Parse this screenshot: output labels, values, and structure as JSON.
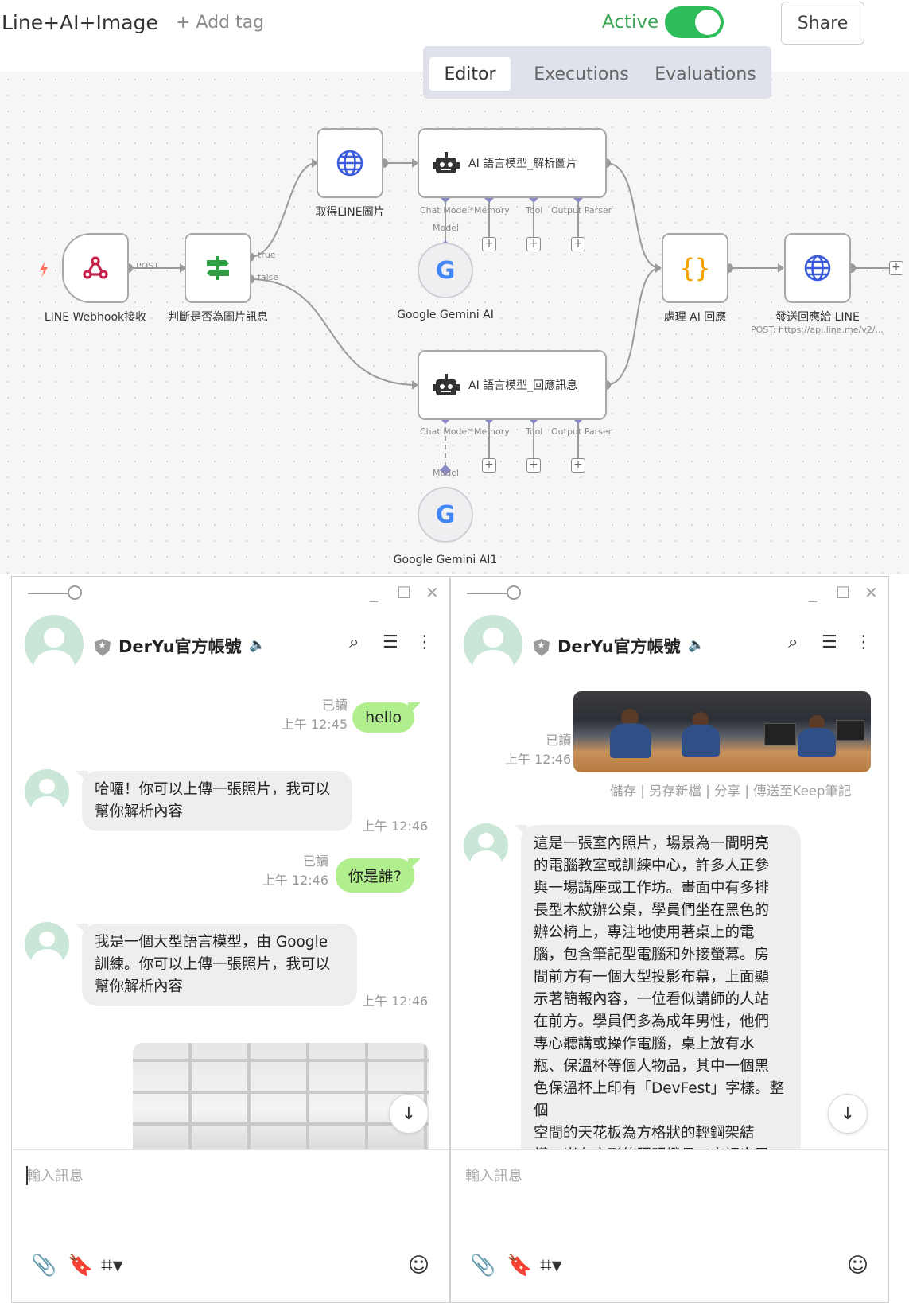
{
  "header": {
    "workflow_title": "Line+AI+Image",
    "add_tag": "+ Add tag",
    "active_label": "Active",
    "share": "Share",
    "tabs": [
      {
        "label": "Editor"
      },
      {
        "label": "Executions"
      },
      {
        "label": "Evaluations"
      }
    ]
  },
  "workflow": {
    "nodes": {
      "webhook": {
        "label": "LINE Webhook接收",
        "icon": "webhook-icon"
      },
      "switch": {
        "label": "判斷是否為圖片訊息",
        "icon": "signpost-icon"
      },
      "get_image": {
        "label": "取得LINE圖片",
        "icon": "globe-icon"
      },
      "agent_image": {
        "label": "AI 語言模型_解析圖片",
        "icon": "robot-icon"
      },
      "agent_reply": {
        "label": "AI 語言模型_回應訊息",
        "icon": "robot-icon"
      },
      "gemini1": {
        "label": "Google Gemini AI",
        "glyph": "G"
      },
      "gemini2": {
        "label": "Google Gemini AI1",
        "glyph": "G"
      },
      "process": {
        "label": "處理 AI 回應",
        "glyph": "{}"
      },
      "send": {
        "label": "發送回應給 LINE",
        "sub": "POST: https://api.line.me/v2/..."
      }
    },
    "edge_labels": {
      "post": "POST",
      "true": "true",
      "false": "false"
    },
    "agent_ports": {
      "chat_model": "Chat Model*",
      "memory": "Memory",
      "tool": "Tool",
      "output_parser": "Output Parser",
      "model": "Model"
    },
    "colors": {
      "active": "#2fbd5c",
      "trigger": "#ff6d5a",
      "globe": "#3b5bdb",
      "switch": "#2f9e44",
      "code": "#f59f00"
    }
  },
  "chat_left": {
    "account": "DerYu官方帳號",
    "messages": [
      {
        "meta_read": "已讀",
        "meta_time": "上午 12:45",
        "text": "hello"
      },
      {
        "text": "哈囉！你可以上傳一張照片，我可以\n幫你解析內容",
        "time": "上午 12:46"
      },
      {
        "meta_read": "已讀",
        "meta_time": "上午 12:46",
        "text": "你是誰?"
      },
      {
        "text": "我是一個大型語言模型，由 Google\n訓練。你可以上傳一張照片，我可以\n幫你解析內容",
        "time": "上午 12:46"
      }
    ],
    "composer_placeholder": "輸入訊息"
  },
  "chat_right": {
    "account": "DerYu官方帳號",
    "image_meta": {
      "read": "已讀",
      "time": "上午 12:46"
    },
    "image_actions": "儲存 | 另存新檔 | 分享 | 傳送至Keep筆記",
    "reply_text": "這是一張室內照片，場景為一間明亮\n的電腦教室或訓練中心，許多人正參\n與一場講座或工作坊。畫面中有多排\n長型木紋辦公桌，學員們坐在黑色的\n辦公椅上，專注地使用著桌上的電\n腦，包含筆記型電腦和外接螢幕。房\n間前方有一個大型投影布幕，上面顯\n示著簡報內容，一位看似講師的人站\n在前方。學員們多為成年男性，他們\n專心聽講或操作電腦，桌上放有水\n瓶、保溫杯等個人物品，其中一個黑\n色保溫杯上印有「DevFest」字樣。整個\n空間的天花板為方格狀的輕鋼架結\n構，嵌有方形的照明燈具、空調出風",
    "composer_placeholder": "輸入訊息"
  }
}
